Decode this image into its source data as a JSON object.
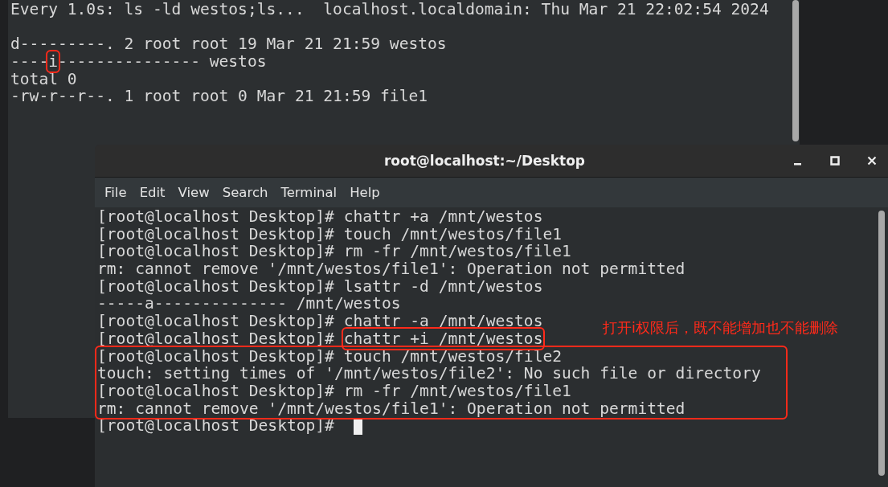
{
  "background_terminal": {
    "lines": [
      {
        "kind": "text",
        "segments": [
          {
            "text": "Every 1.0s: ls -ld westos;ls...  localhost.localdomain: Thu Mar 21 22:02:54 2024",
            "boxed": false
          }
        ]
      },
      {
        "kind": "blank"
      },
      {
        "kind": "text",
        "segments": [
          {
            "text": "d---------. 2 root root 19 Mar 21 21:59 westos",
            "boxed": false
          }
        ]
      },
      {
        "kind": "text",
        "segments": [
          {
            "text": "----",
            "boxed": false
          },
          {
            "text": "i",
            "boxed": true
          },
          {
            "text": "--------------- westos",
            "boxed": false
          }
        ]
      },
      {
        "kind": "text",
        "segments": [
          {
            "text": "total 0",
            "boxed": false
          }
        ]
      },
      {
        "kind": "text",
        "segments": [
          {
            "text": "-rw-r--r--. 1 root root 0 Mar 21 21:59 file1",
            "boxed": false
          }
        ]
      }
    ]
  },
  "window": {
    "title": "root@localhost:~/Desktop"
  },
  "menu": [
    "File",
    "Edit",
    "View",
    "Search",
    "Terminal",
    "Help"
  ],
  "terminal": {
    "blocks": [
      {
        "boxed": false,
        "lines": [
          {
            "segments": [
              {
                "text": "[root@localhost Desktop]# chattr +a /mnt/westos",
                "boxed": false
              }
            ]
          },
          {
            "segments": [
              {
                "text": "[root@localhost Desktop]# touch /mnt/westos/file1",
                "boxed": false
              }
            ]
          },
          {
            "segments": [
              {
                "text": "[root@localhost Desktop]# rm -fr /mnt/westos/file1",
                "boxed": false
              }
            ]
          },
          {
            "segments": [
              {
                "text": "rm: cannot remove '/mnt/westos/file1': Operation not permitted",
                "boxed": false
              }
            ]
          },
          {
            "segments": [
              {
                "text": "[root@localhost Desktop]# lsattr -d /mnt/westos",
                "boxed": false
              }
            ]
          },
          {
            "segments": [
              {
                "text": "-----a-------------- /mnt/westos",
                "boxed": false
              }
            ]
          },
          {
            "segments": [
              {
                "text": "[root@localhost Desktop]# chattr -a /mnt/westos",
                "boxed": false
              }
            ]
          },
          {
            "segments": [
              {
                "text": "[root@localhost Desktop]# ",
                "boxed": false
              },
              {
                "text": "chattr +i /mnt/westos",
                "boxed": true
              }
            ]
          }
        ]
      },
      {
        "boxed": true,
        "lines": [
          {
            "segments": [
              {
                "text": "[root@localhost Desktop]# touch /mnt/westos/file2",
                "boxed": false
              }
            ]
          },
          {
            "segments": [
              {
                "text": "touch: setting times of '/mnt/westos/file2': No such file or directory",
                "boxed": false
              }
            ]
          },
          {
            "segments": [
              {
                "text": "[root@localhost Desktop]# rm -fr /mnt/westos/file1",
                "boxed": false
              }
            ]
          },
          {
            "segments": [
              {
                "text": "rm: cannot remove '/mnt/westos/file1': Operation not permitted",
                "boxed": false
              }
            ]
          }
        ]
      },
      {
        "boxed": false,
        "lines": [
          {
            "segments": [
              {
                "text": "[root@localhost Desktop]# ",
                "boxed": false
              }
            ],
            "cursor": true
          }
        ]
      }
    ]
  },
  "annotation": "打开i权限后，既不能增加也不能删除"
}
